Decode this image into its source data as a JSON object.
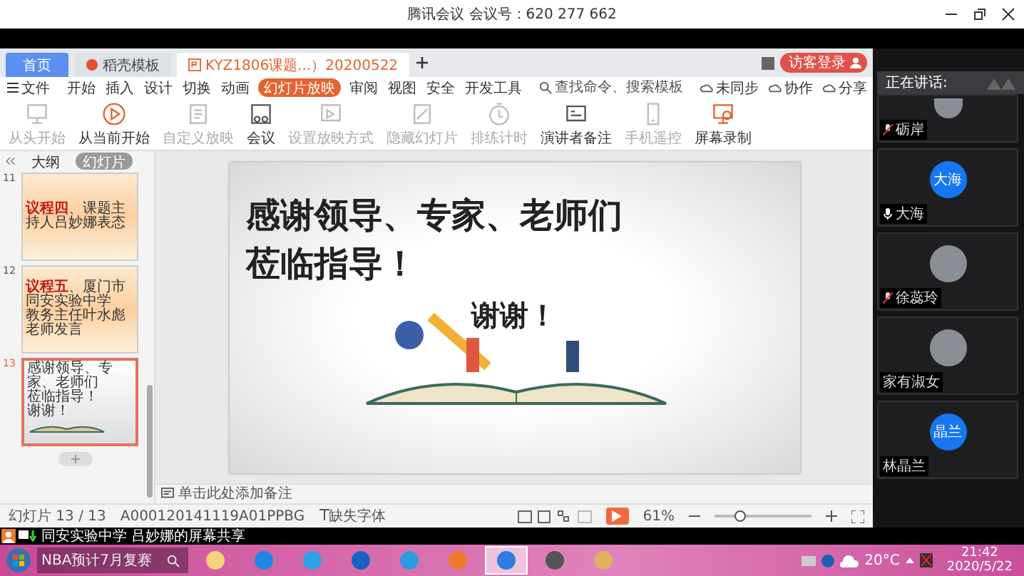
{
  "meeting_bar": {
    "title": "腾讯会议 会议号：620 277 662"
  },
  "wps": {
    "tabs": [
      {
        "label": "首页",
        "kind": "home",
        "selected": false
      },
      {
        "label": "稻壳模板",
        "kind": "template",
        "selected": false
      },
      {
        "label": "KYZ1806课题...）20200522",
        "kind": "document",
        "selected": true
      }
    ],
    "login_button": "访客登录",
    "file_menu": "文件",
    "menu_tabs": [
      {
        "label": "开始",
        "selected": false
      },
      {
        "label": "插入",
        "selected": false
      },
      {
        "label": "设计",
        "selected": false
      },
      {
        "label": "切换",
        "selected": false
      },
      {
        "label": "动画",
        "selected": false
      },
      {
        "label": "幻灯片放映",
        "selected": true
      },
      {
        "label": "审阅",
        "selected": false
      },
      {
        "label": "视图",
        "selected": false
      },
      {
        "label": "安全",
        "selected": false
      },
      {
        "label": "开发工具",
        "selected": false
      }
    ],
    "search": {
      "placeholder": "查找命令、搜索模板"
    },
    "menu_actions": [
      "未同步",
      "协作",
      "分享"
    ],
    "ribbon": [
      {
        "label": "从头开始",
        "disabled": true
      },
      {
        "label": "从当前开始",
        "disabled": false
      },
      {
        "label": "自定义放映",
        "disabled": true
      },
      {
        "label": "会议",
        "disabled": false
      },
      {
        "label": "设置放映方式",
        "disabled": true
      },
      {
        "label": "隐藏幻灯片",
        "disabled": true
      },
      {
        "label": "排练计时",
        "disabled": true
      },
      {
        "label": "演讲者备注",
        "disabled": false
      },
      {
        "label": "手机遥控",
        "disabled": true
      },
      {
        "label": "屏幕录制",
        "disabled": false
      }
    ],
    "panel_tabs": [
      {
        "label": "大纲",
        "selected": false
      },
      {
        "label": "幻灯片",
        "selected": true
      }
    ],
    "thumbnails": [
      {
        "number": "11",
        "selected": false,
        "kind": "agenda",
        "lines": [
          {
            "highlight": "议程四",
            "text": "、课题主持人吕妙娜表态"
          }
        ]
      },
      {
        "number": "12",
        "selected": false,
        "kind": "agenda",
        "lines": [
          {
            "highlight": "议程五",
            "text": "、厦门市同安实验中学"
          },
          {
            "text": "教务主任叶水彪老师发言"
          }
        ]
      },
      {
        "number": "13",
        "selected": true,
        "kind": "closing",
        "lines": [
          {
            "text": "感谢领导、专家、老师们"
          },
          {
            "text": "莅临指导！"
          },
          {
            "text": "谢谢！"
          }
        ]
      }
    ],
    "slide": {
      "lines": [
        "感谢领导、专家、老师们",
        "莅临指导！"
      ],
      "closing": "谢谢！"
    },
    "notes": {
      "placeholder": "单击此处添加备注"
    },
    "status": {
      "slide_counter": "幻灯片 13 / 13",
      "template_id": "A000120141119A01PPBG",
      "missing_fonts": "缺失字体",
      "zoom": "61%",
      "zoom_slider": {
        "level": 0.27
      }
    }
  },
  "meeting_panel": {
    "speaking_label": "正在讲话:",
    "participants": [
      {
        "name": "砺岸",
        "kind": "muted"
      },
      {
        "name": "大海",
        "kind": "unmuted",
        "avatar_text": "大海"
      },
      {
        "name": "徐蕊玲",
        "kind": "muted"
      },
      {
        "name": "家有淑女",
        "kind": "no_mic"
      },
      {
        "name": "林晶兰",
        "kind": "no_mic",
        "avatar_text": "晶兰"
      }
    ]
  },
  "share_banner": "同安实验中学 吕妙娜的屏幕共享",
  "taskbar": {
    "search": {
      "placeholder": "NBA预计7月复赛"
    },
    "apps": [
      {
        "selected": false
      },
      {
        "selected": false
      },
      {
        "selected": false
      },
      {
        "selected": false
      },
      {
        "selected": false
      },
      {
        "selected": false
      },
      {
        "selected": true
      },
      {
        "selected": false
      },
      {
        "selected": false
      }
    ],
    "temperature": "20°C",
    "time": "21:42",
    "date": "2020/5/22"
  }
}
